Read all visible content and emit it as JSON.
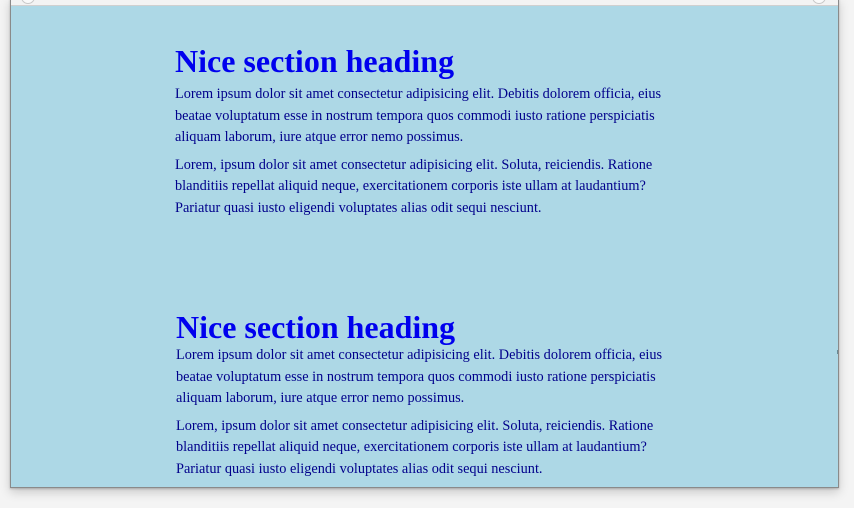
{
  "sections": [
    {
      "heading": "Nice section heading",
      "paragraphs": [
        "Lorem ipsum dolor sit amet consectetur adipisicing elit. Debitis dolorem officia, eius beatae voluptatum esse in nostrum tempora quos commodi iusto ratione perspiciatis aliquam laborum, iure atque error nemo possimus.",
        "Lorem, ipsum dolor sit amet consectetur adipisicing elit. Soluta, reiciendis. Ratione blanditiis repellat aliquid neque, exercitationem corporis iste ullam at laudantium? Pariatur quasi iusto eligendi voluptates alias odit sequi nesciunt."
      ]
    },
    {
      "heading": "Nice section heading",
      "paragraphs": [
        "Lorem ipsum dolor sit amet consectetur adipisicing elit. Debitis dolorem officia, eius beatae voluptatum esse in nostrum tempora quos commodi iusto ratione perspiciatis aliquam laborum, iure atque error nemo possimus.",
        "Lorem, ipsum dolor sit amet consectetur adipisicing elit. Soluta, reiciendis. Ratione blanditiis repellat aliquid neque, exercitationem corporis iste ullam at laudantium? Pariatur quasi iusto eligendi voluptates alias odit sequi nesciunt."
      ]
    }
  ],
  "colors": {
    "page_background": "#add8e6",
    "heading": "#0000ee",
    "body_text": "#00008b"
  }
}
